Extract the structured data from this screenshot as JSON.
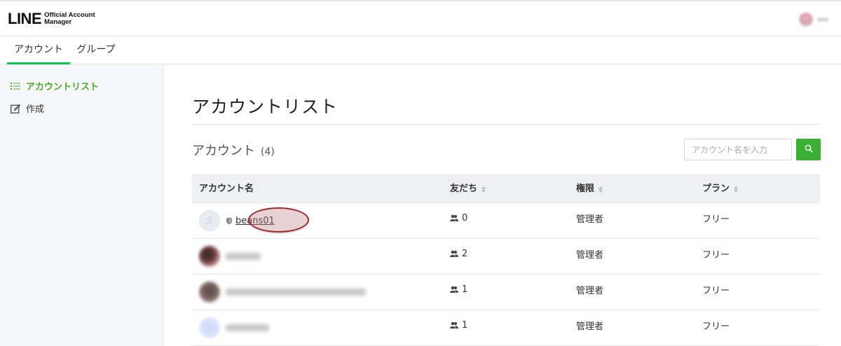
{
  "header": {
    "logo_main": "LINE",
    "logo_sub_1": "Official Account",
    "logo_sub_2": "Manager"
  },
  "tabs": [
    {
      "label": "アカウント",
      "active": true
    },
    {
      "label": "グループ",
      "active": false
    }
  ],
  "sidebar": {
    "items": [
      {
        "label": "アカウントリスト",
        "icon": "list-icon",
        "active": true
      },
      {
        "label": "作成",
        "icon": "edit-icon",
        "active": false
      }
    ]
  },
  "main": {
    "page_title": "アカウントリスト",
    "section_title": "アカウント",
    "section_count": "(4)",
    "search": {
      "placeholder": "アカウント名を入力",
      "value": ""
    },
    "table": {
      "columns": [
        "アカウント名",
        "友だち",
        "権限",
        "プラン"
      ],
      "rows": [
        {
          "name": "beans01",
          "friends": "0",
          "role": "管理者",
          "plan": "フリー"
        },
        {
          "name": "",
          "friends": "2",
          "role": "管理者",
          "plan": "フリー"
        },
        {
          "name": "",
          "friends": "1",
          "role": "管理者",
          "plan": "フリー"
        },
        {
          "name": "",
          "friends": "1",
          "role": "管理者",
          "plan": "フリー"
        }
      ]
    }
  },
  "colors": {
    "accent_green": "#06c755",
    "sidebar_active": "#4aa82a",
    "search_button": "#3cb034",
    "highlight_border": "#9b2b33"
  }
}
